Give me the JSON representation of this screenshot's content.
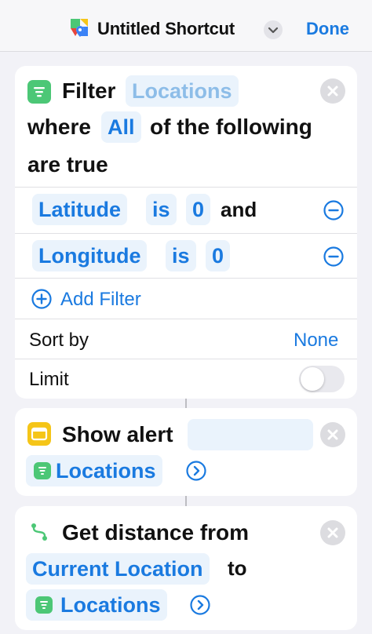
{
  "nav": {
    "title": "Untitled Shortcut",
    "done_label": "Done"
  },
  "filter_action": {
    "title": "Filter",
    "source": "Locations",
    "where_label": "where",
    "match_mode": "All",
    "of_following_label": "of the following",
    "are_true_label": "are true",
    "conditions": [
      {
        "property": "Latitude",
        "operator": "is",
        "value": "0",
        "conjunction": "and"
      },
      {
        "property": "Longitude",
        "operator": "is",
        "value": "0"
      }
    ],
    "add_filter_label": "Add Filter",
    "sort_by_label": "Sort by",
    "sort_by_value": "None",
    "limit_label": "Limit",
    "limit_enabled": false
  },
  "show_alert_action": {
    "title": "Show alert",
    "input": "Locations"
  },
  "distance_action": {
    "title": "Get distance from",
    "from": "Current Location",
    "to_label": "to",
    "to_value": "Locations"
  },
  "colors": {
    "accent": "#1a7ae0",
    "filter_icon": "#4cc776",
    "alert_icon": "#f5c518",
    "maps_icon": "#4cc776"
  }
}
